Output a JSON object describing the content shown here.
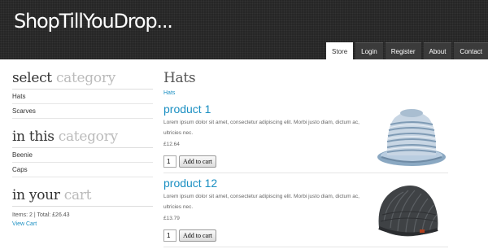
{
  "site": {
    "logo": "ShopTillYouDrop..."
  },
  "nav": [
    {
      "label": "Store",
      "active": true
    },
    {
      "label": "Login",
      "active": false
    },
    {
      "label": "Register",
      "active": false
    },
    {
      "label": "About",
      "active": false
    },
    {
      "label": "Contact",
      "active": false
    }
  ],
  "sidebar": {
    "category_heading": {
      "main": "select ",
      "accent": "category"
    },
    "categories": [
      "Hats",
      "Scarves"
    ],
    "subcategory_heading": {
      "main": "in this ",
      "accent": "category"
    },
    "subcategories": [
      "Beenie",
      "Caps"
    ],
    "cart_heading": {
      "main": "in your ",
      "accent": "cart"
    },
    "cart_summary": "Items: 2 | Total: £26.43",
    "cart_link": "View Cart"
  },
  "main": {
    "title": "Hats",
    "breadcrumb": "Hats",
    "products": [
      {
        "name": "product 1",
        "description": "Lorem ipsum dolor sit amet, consectetur adipiscing elit. Morbi justo diam, dictum ac, ultricies nec.",
        "price": "£12.64",
        "quantity": "1",
        "button": "Add to cart",
        "image": "striped-bucket-hat-image"
      },
      {
        "name": "product 12",
        "description": "Lorem ipsum dolor sit amet, consectetur adipiscing elit. Morbi justo diam, dictum ac, ultricies nec.",
        "price": "£13.79",
        "quantity": "1",
        "button": "Add to cart",
        "image": "knit-beanie-image"
      }
    ]
  },
  "colors": {
    "header_bg": "#262626",
    "link": "#1a8fc2",
    "heading_accent": "#bbbbbb"
  }
}
